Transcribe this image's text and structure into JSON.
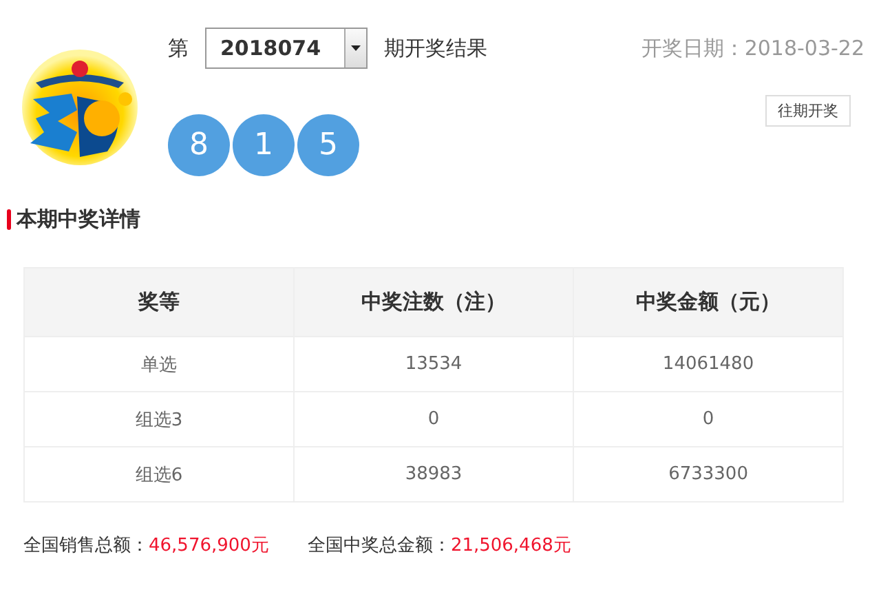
{
  "header": {
    "prefix": "第",
    "issue": "2018074",
    "suffix": "期开奖结果",
    "draw_date": "开奖日期：2018-03-22",
    "history_button": "往期开奖"
  },
  "balls": [
    "8",
    "1",
    "5"
  ],
  "section_title": "本期中奖详情",
  "table": {
    "columns": [
      "奖等",
      "中奖注数（注）",
      "中奖金额（元）"
    ],
    "rows": [
      [
        "单选",
        "13534",
        "14061480"
      ],
      [
        "组选3",
        "0",
        "0"
      ],
      [
        "组选6",
        "38983",
        "6733300"
      ]
    ]
  },
  "totals": [
    {
      "label": "全国销售总额：",
      "value": "46,576,900元"
    },
    {
      "label": "全国中奖总金额：",
      "value": "21,506,468元"
    }
  ]
}
